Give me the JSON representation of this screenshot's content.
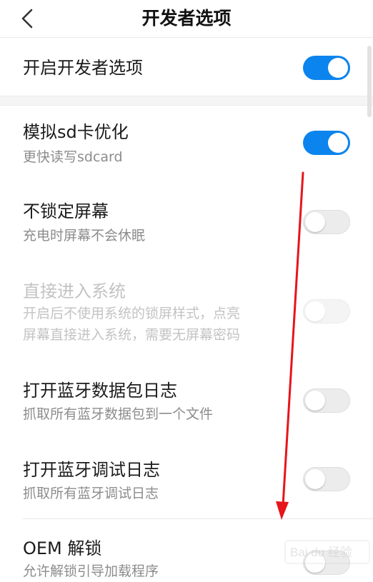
{
  "header": {
    "title": "开发者选项"
  },
  "settings": [
    {
      "label": "开启开发者选项",
      "state": "on"
    },
    {
      "label": "模拟sd卡优化",
      "sub": "更快读写sdcard",
      "state": "on"
    },
    {
      "label": "不锁定屏幕",
      "sub": "充电时屏幕不会休眠",
      "state": "off"
    },
    {
      "label": "直接进入系统",
      "sub": "开启后不使用系统的锁屏样式，点亮",
      "sub2": "屏幕直接进入系统，需要无屏幕密码",
      "state": "disabled"
    },
    {
      "label": "打开蓝牙数据包日志",
      "sub": "抓取所有蓝牙数据包到一个文件",
      "state": "off"
    },
    {
      "label": "打开蓝牙调试日志",
      "sub": "抓取所有蓝牙调试日志",
      "state": "off"
    },
    {
      "label": "OEM 解锁",
      "sub": "允许解锁引导加载程序",
      "state": "off"
    }
  ],
  "colors": {
    "accent": "#0b84ee",
    "annotation_arrow": "#e8141b"
  },
  "watermark": {
    "text": "Bai du 经验"
  }
}
